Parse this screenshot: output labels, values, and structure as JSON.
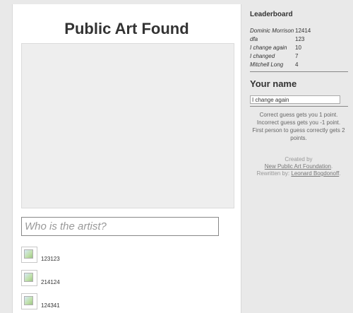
{
  "main": {
    "title": "Public Art Found",
    "guess_placeholder": "Who is the artist?",
    "guesses": [
      {
        "label": "123123"
      },
      {
        "label": "214124"
      },
      {
        "label": "124341"
      }
    ]
  },
  "sidebar": {
    "leaderboard_heading": "Leaderboard",
    "leaderboard": [
      {
        "name": "Dominic Morrison",
        "score": "12414"
      },
      {
        "name": "dfa",
        "score": "123"
      },
      {
        "name": "I change again",
        "score": "10"
      },
      {
        "name": "I changed",
        "score": "7"
      },
      {
        "name": "Mitchell Long",
        "score": "4"
      }
    ],
    "your_name_heading": "Your name",
    "name_value": "I change again",
    "rules": [
      "Correct guess gets you 1 point.",
      "Incorrect guess gets you -1 point.",
      "First person to guess correctly gets 2",
      "points."
    ],
    "credits": {
      "created_by": "Created by",
      "foundation_link": "New Public Art Foundation",
      "period": ".",
      "rewritten_by": "Rewritten by: ",
      "author_link": "Leonard Bogdonoff",
      "trailing_period": "."
    }
  }
}
